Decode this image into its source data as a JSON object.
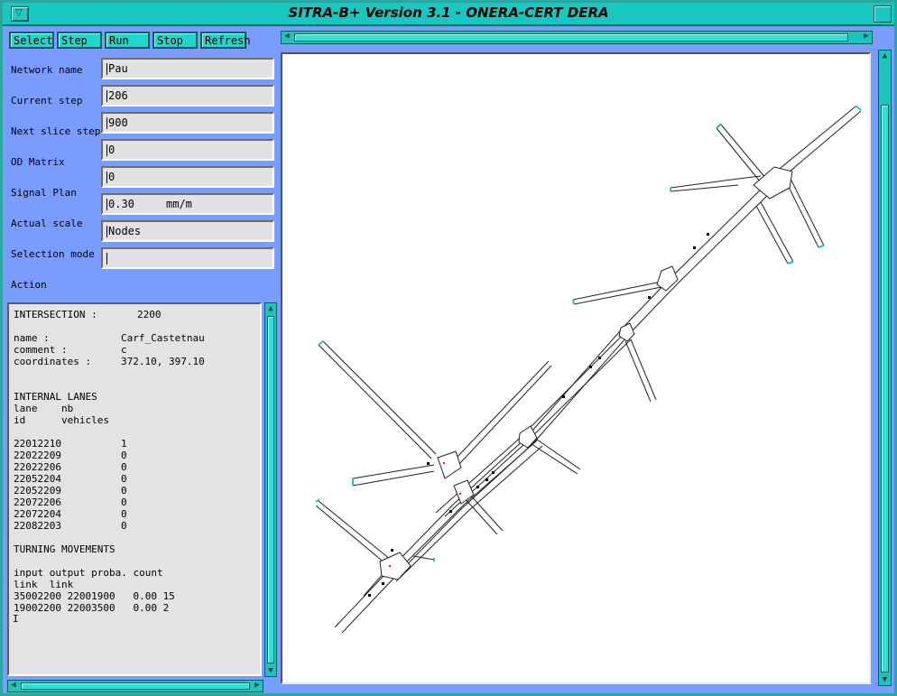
{
  "window": {
    "title": "SITRA-B+ Version 3.1 - ONERA-CERT DERA"
  },
  "toolbar": {
    "buttons": [
      "Select",
      "Step",
      "Run",
      "Stop",
      "Refresh"
    ]
  },
  "fields": [
    {
      "label": "Network name",
      "value": "Pau"
    },
    {
      "label": "Current step",
      "value": "206"
    },
    {
      "label": "Next slice step",
      "value": "900"
    },
    {
      "label": "OD Matrix",
      "value": "0"
    },
    {
      "label": "",
      "value": "0"
    },
    {
      "label": "Signal Plan",
      "value": "0.30",
      "unit": "mm/m"
    },
    {
      "label": "Actual scale",
      "value": "Nodes"
    },
    {
      "label": "Selection mode",
      "value": ""
    }
  ],
  "action_label": "Action",
  "info": {
    "intersection_label": "INTERSECTION :",
    "intersection_id": "2200",
    "name_label": "name :",
    "name_value": "Carf_Castetnau",
    "comment_label": "comment :",
    "comment_value": "c",
    "coords_label": "coordinates :",
    "coords_value": "372.10, 397.10",
    "internal_lanes_title": "INTERNAL LANES",
    "lanes_header1": "lane    nb",
    "lanes_header2": "id      vehicles",
    "lanes": [
      {
        "id": "22012210",
        "nb": "1"
      },
      {
        "id": "22022209",
        "nb": "0"
      },
      {
        "id": "22022206",
        "nb": "0"
      },
      {
        "id": "22052204",
        "nb": "0"
      },
      {
        "id": "22052209",
        "nb": "0"
      },
      {
        "id": "22072206",
        "nb": "0"
      },
      {
        "id": "22072204",
        "nb": "0"
      },
      {
        "id": "22082203",
        "nb": "0"
      }
    ],
    "turning_title": "TURNING MOVEMENTS",
    "turn_header1": "input output proba. count",
    "turn_header2": "link  link",
    "turns": [
      "35002200 22001900   0.00 15",
      "19002200 22003500   0.00 2"
    ]
  }
}
